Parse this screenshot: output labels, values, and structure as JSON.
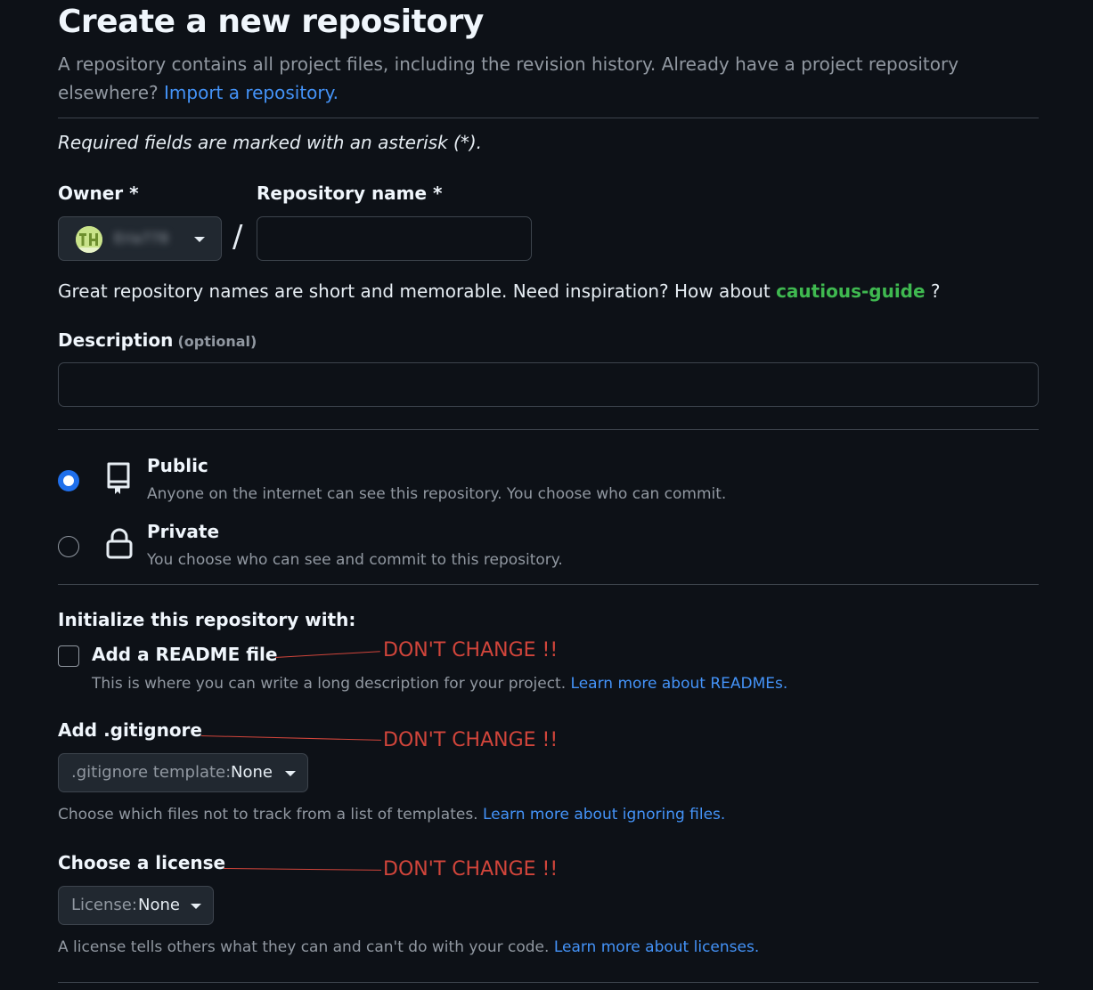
{
  "page": {
    "title": "Create a new repository",
    "subtitle": "A repository contains all project files, including the revision history. Already have a project repository elsewhere?",
    "import_link": "Import a repository.",
    "required_note": "Required fields are marked with an asterisk (*)."
  },
  "owner": {
    "label": "Owner *",
    "username": "Eria778"
  },
  "separator": "/",
  "repo_name": {
    "label": "Repository name *",
    "value": ""
  },
  "name_hint": {
    "text": "Great repository names are short and memorable. Need inspiration? How about",
    "suggestion": "cautious-guide",
    "suffix": "?"
  },
  "description": {
    "label": "Description",
    "optional": "(optional)",
    "value": ""
  },
  "visibility": {
    "selected": "public",
    "public": {
      "title": "Public",
      "desc": "Anyone on the internet can see this repository. You choose who can commit.",
      "icon": "repo-icon"
    },
    "private": {
      "title": "Private",
      "desc": "You choose who can see and commit to this repository.",
      "icon": "lock-icon"
    }
  },
  "initialize": {
    "heading": "Initialize this repository with:",
    "readme": {
      "label": "Add a README file",
      "checked": false,
      "desc": "This is where you can write a long description for your project.",
      "link": "Learn more about READMEs."
    }
  },
  "gitignore": {
    "label": "Add .gitignore",
    "select_prefix": ".gitignore template:",
    "select_value": "None",
    "desc": "Choose which files not to track from a list of templates.",
    "link": "Learn more about ignoring files."
  },
  "license": {
    "label": "Choose a license",
    "select_prefix": "License:",
    "select_value": "None",
    "desc": "A license tells others what they can and can't do with your code.",
    "link": "Learn more about licenses."
  },
  "annotations": {
    "readme": "DON'T CHANGE !!",
    "gitignore": "DON'T CHANGE !!",
    "license": "DON'T CHANGE !!"
  },
  "colors": {
    "background": "#0d1117",
    "accent_link": "#4493f8",
    "suggestion_green": "#3fb950",
    "radio_blue": "#1f6feb",
    "annotation_red": "#d1453b"
  }
}
